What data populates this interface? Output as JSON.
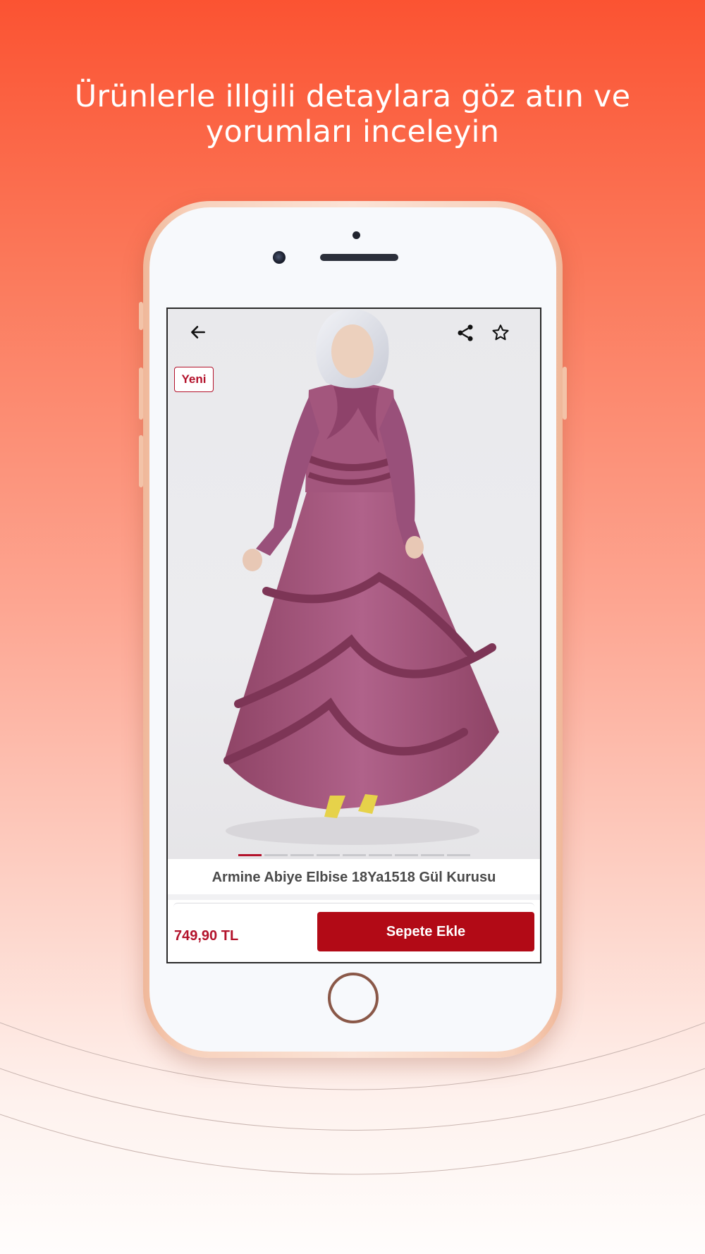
{
  "headline": {
    "line1": "Ürünlerle illgili detaylara göz atın ve",
    "line2": "yorumları inceleyin"
  },
  "icons": {
    "back": "arrow-left-icon",
    "share": "share-icon",
    "favorite": "star-outline-icon"
  },
  "product": {
    "badge": "Yeni",
    "title": "Armine Abiye Elbise 18Ya1518 Gül Kurusu",
    "price": "749,90 TL",
    "image_count": 9,
    "active_image_index": 0
  },
  "actions": {
    "add_to_cart_label": "Sepete Ekle"
  },
  "colors": {
    "accent": "#b20a16",
    "price": "#b3122b",
    "background_top": "#fb5332",
    "dress": "#a15277"
  }
}
